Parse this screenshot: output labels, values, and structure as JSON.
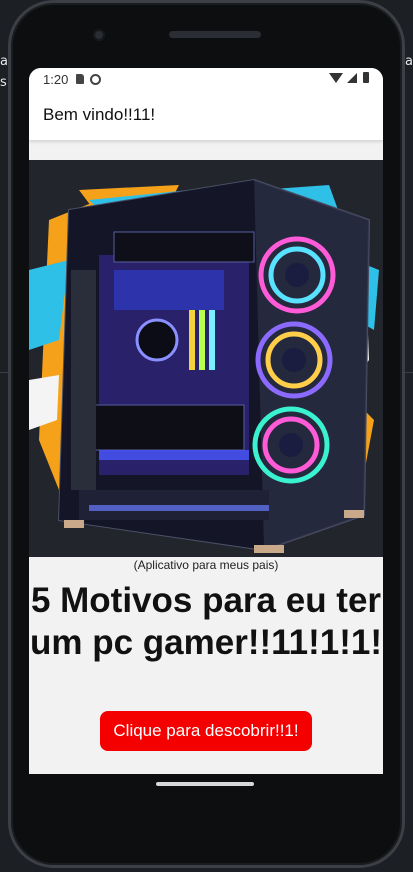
{
  "desktop": {
    "frag_a": "a",
    "frag_b": "s",
    "frag_right": "a"
  },
  "status_bar": {
    "time": "1:20",
    "sd_icon": "sd-card-icon",
    "sync_icon": "data-saver-icon",
    "wifi_icon": "wifi-icon",
    "signal_icon": "signal-icon",
    "battery_icon": "battery-icon"
  },
  "app_bar": {
    "title": "Bem vindo!!11!"
  },
  "hero": {
    "image": "gaming-pc-image"
  },
  "content": {
    "caption": "(Aplicativo para meus pais)",
    "headline": "5 Motivos para eu ter um pc gamer!!11!1!1!",
    "button_label": "Clique para descobrir!!1!"
  },
  "colors": {
    "button": "#f40000",
    "screen_bg": "#f2f2f2",
    "hero_bg": "#23252d"
  }
}
